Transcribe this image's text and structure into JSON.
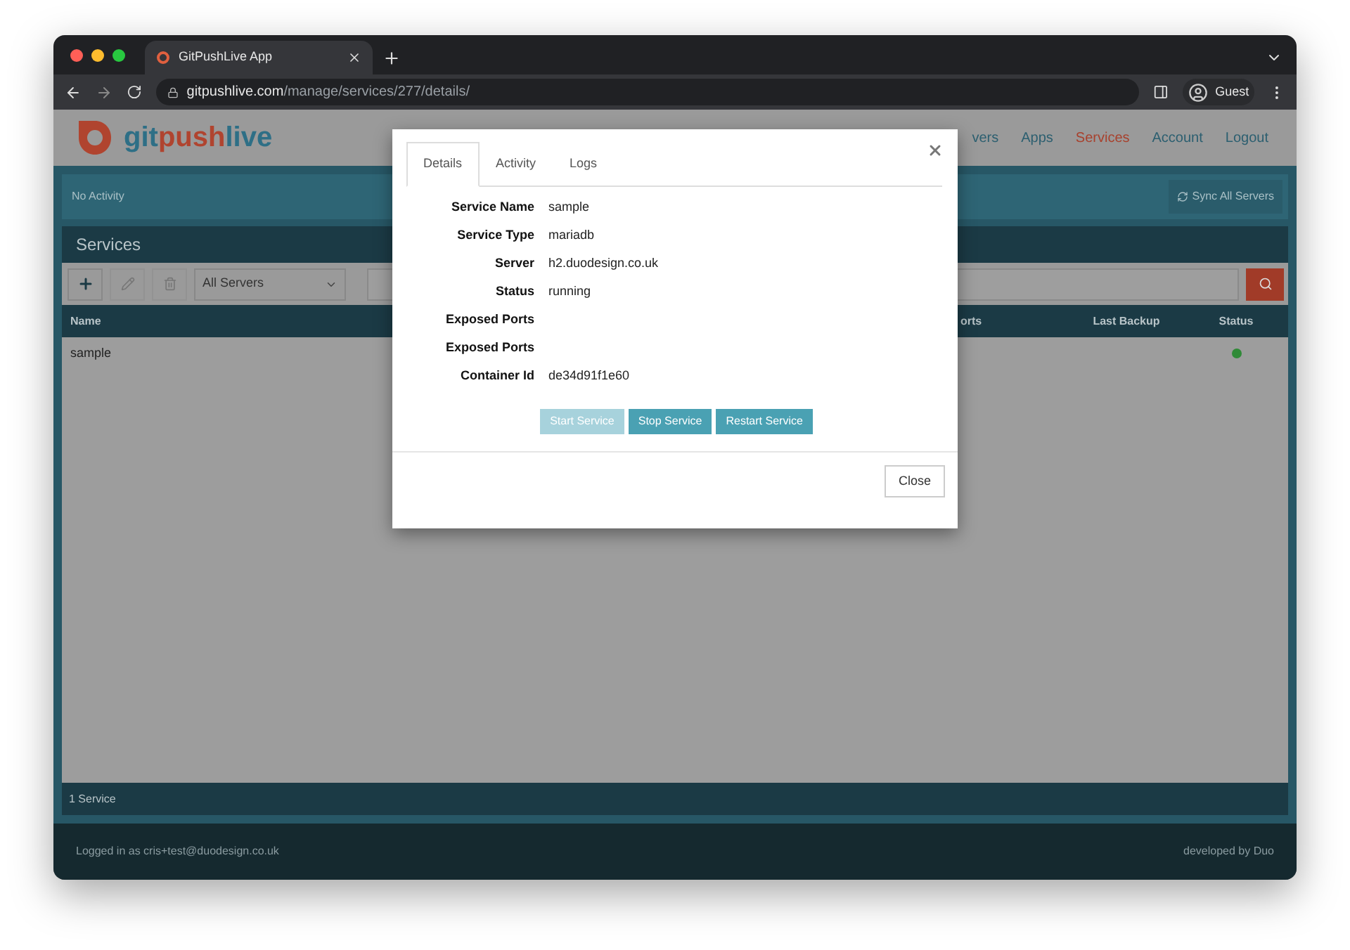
{
  "browser": {
    "tab_title": "GitPushLive App",
    "url_host": "gitpushlive.com",
    "url_path": "/manage/services/277/details/",
    "profile": "Guest"
  },
  "header": {
    "logo_parts": [
      {
        "text": "git",
        "color": "#2e6f86"
      },
      {
        "text": "push",
        "color": "#b0442f"
      },
      {
        "text": "live",
        "color": "#2e6f86"
      }
    ],
    "nav": [
      {
        "label": "vers",
        "selected": false
      },
      {
        "label": "Apps",
        "selected": false
      },
      {
        "label": "Services",
        "selected": true
      },
      {
        "label": "Account",
        "selected": false
      },
      {
        "label": "Logout",
        "selected": false
      }
    ]
  },
  "activity": {
    "text": "No Activity",
    "sync_button": "Sync All Servers"
  },
  "panel": {
    "title": "Services",
    "server_filter": "All Servers",
    "columns": [
      "Name",
      "orts",
      "Last Backup",
      "Status"
    ],
    "rows": [
      {
        "name": "sample",
        "color": "#2f8a37"
      }
    ],
    "footer": "1 Service"
  },
  "footer": {
    "left": "Logged in as cris+test@duodesign.co.uk",
    "right": "developed by Duo"
  },
  "modal": {
    "tabs": [
      {
        "label": "Details",
        "selected": true
      },
      {
        "label": "Activity",
        "selected": false
      },
      {
        "label": "Logs",
        "selected": false
      }
    ],
    "fields": [
      {
        "label": "Service Name",
        "value": "sample"
      },
      {
        "label": "Service Type",
        "value": "mariadb"
      },
      {
        "label": "Server",
        "value": "h2.duodesign.co.uk"
      },
      {
        "label": "Status",
        "value": "running"
      },
      {
        "label": "Exposed Ports"
      },
      {
        "label": "Exposed Ports"
      },
      {
        "label": "Container Id",
        "value": "de34d91f1e60"
      }
    ],
    "actions": [
      {
        "label": "Start Service",
        "disabled": true
      },
      {
        "label": "Stop Service",
        "disabled": false
      },
      {
        "label": "Restart Service",
        "disabled": false
      }
    ],
    "close_button": "Close"
  }
}
